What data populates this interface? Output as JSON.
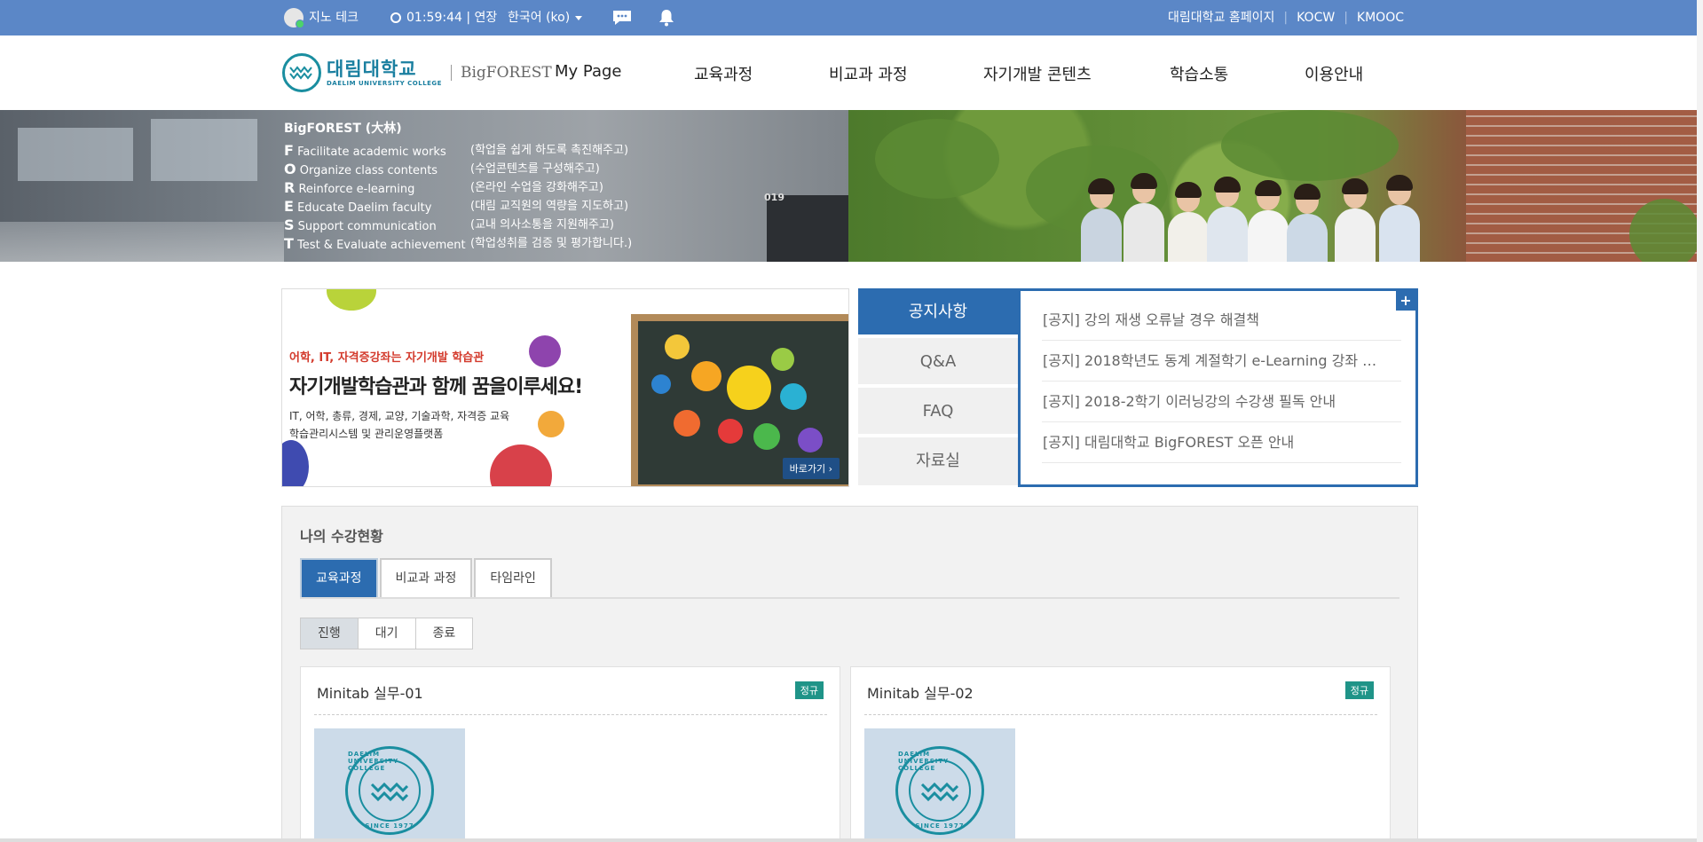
{
  "topbar": {
    "user_name": "지노 테크",
    "time": "01:59:44 | 연장",
    "language": "한국어 (ko)",
    "links": [
      "대림대학교 홈페이지",
      "KOCW",
      "KMOOC"
    ]
  },
  "header": {
    "logo_ko": "대림대학교",
    "logo_en": "DAELIM UNIVERSITY COLLEGE",
    "product": "BigFOREST",
    "menu": [
      "My Page",
      "교육과정",
      "비교과 과정",
      "자기개발 콘텐츠",
      "학습소통",
      "이용안내"
    ]
  },
  "banner": {
    "title": "BigFOREST (大林)",
    "rows": [
      {
        "letter": "F",
        "text": "Facilitate academic works",
        "desc": "(학업을 쉽게 하도록 촉진해주고)"
      },
      {
        "letter": "O",
        "text": "Organize class contents",
        "desc": "(수업콘텐츠를 구성해주고)"
      },
      {
        "letter": "R",
        "text": "Reinforce e-learning",
        "desc": "(온라인 수업을 강화해주고)"
      },
      {
        "letter": "E",
        "text": "Educate Daelim faculty",
        "desc": "(대림 교직원의 역량을 지도하고)"
      },
      {
        "letter": "S",
        "text": "Support communication",
        "desc": "(교내 의사소통을 지원해주고)"
      },
      {
        "letter": "T",
        "text": "Test & Evaluate achievement",
        "desc": "(학업성취를 검증 및 평가합니다.)"
      }
    ],
    "room_label": "019"
  },
  "promo": {
    "sub": "어학, IT, 자격증강좌는 자기개발 학습관",
    "headline": "자기개발학습관과 함께 꿈을이루세요!",
    "desc1": "IT, 어학, 총류, 경제, 교양, 기술과학, 자격증 교육",
    "desc2": "학습관리시스템 및 관리운영플랫폼",
    "button": "바로가기"
  },
  "notice": {
    "tabs": [
      "공지사항",
      "Q&A",
      "FAQ",
      "자료실"
    ],
    "items": [
      "[공지] 강의 재생 오류날 경우 해결책",
      "[공지] 2018학년도 동계 계절학기 e-Learning 강좌 …",
      "[공지] 2018-2학기 이러닝강의 수강생 필독 안내",
      "[공지] 대림대학교 BigFOREST 오픈 안내"
    ],
    "more": "+"
  },
  "courses": {
    "title": "나의 수강현황",
    "tabs": [
      "교육과정",
      "비교과 과정",
      "타임라인"
    ],
    "status_tabs": [
      "진행",
      "대기",
      "종료"
    ],
    "cards": [
      {
        "title": "Minitab 실무-01",
        "badge": "정규"
      },
      {
        "title": "Minitab 실무-02",
        "badge": "정규"
      }
    ],
    "seal_top": "DAELIM UNIVERSITY COLLEGE",
    "seal_bottom": "SINCE 1977"
  },
  "colors": {
    "topbar": "#5b87c7",
    "accent": "#2c6cb0",
    "badge": "#1f9488",
    "brand": "#1a8ea0"
  }
}
